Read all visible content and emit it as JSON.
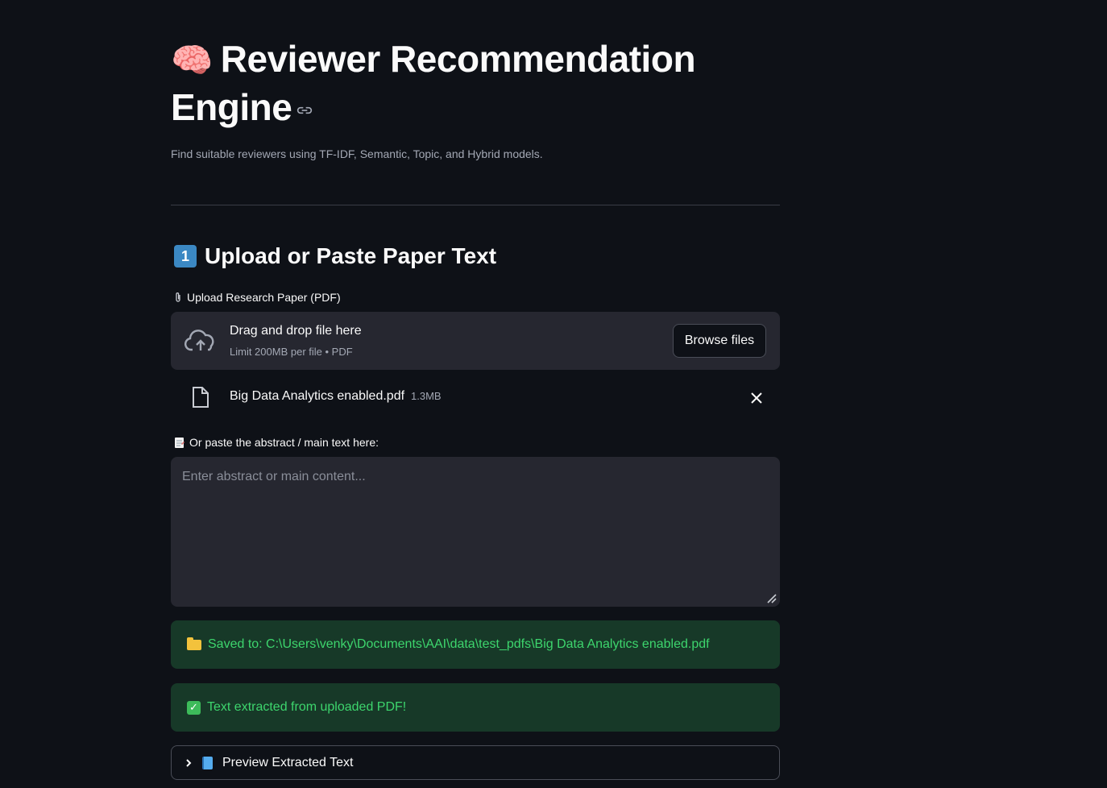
{
  "header": {
    "title": "Reviewer Recommendation Engine",
    "subtitle": "Find suitable reviewers using TF-IDF, Semantic, Topic, and Hybrid models."
  },
  "section1": {
    "heading": "Upload or Paste Paper Text",
    "badge": "1"
  },
  "uploader": {
    "label": "Upload Research Paper (PDF)",
    "drag_text": "Drag and drop file here",
    "limit_text": "Limit 200MB per file • PDF",
    "browse_label": "Browse files",
    "file_name": "Big Data Analytics enabled.pdf",
    "file_size": "1.3MB"
  },
  "paste": {
    "label": "Or paste the abstract / main text here:",
    "placeholder": "Enter abstract or main content..."
  },
  "alerts": {
    "saved": "Saved to: C:\\Users\\venky\\Documents\\AAI\\data\\test_pdfs\\Big Data Analytics enabled.pdf",
    "extracted": "Text extracted from uploaded PDF!"
  },
  "expander": {
    "label": "Preview Extracted Text"
  },
  "colors": {
    "background": "#0e1117",
    "surface": "#262730",
    "success_bg": "#173928",
    "success_text": "#3dd56d"
  }
}
